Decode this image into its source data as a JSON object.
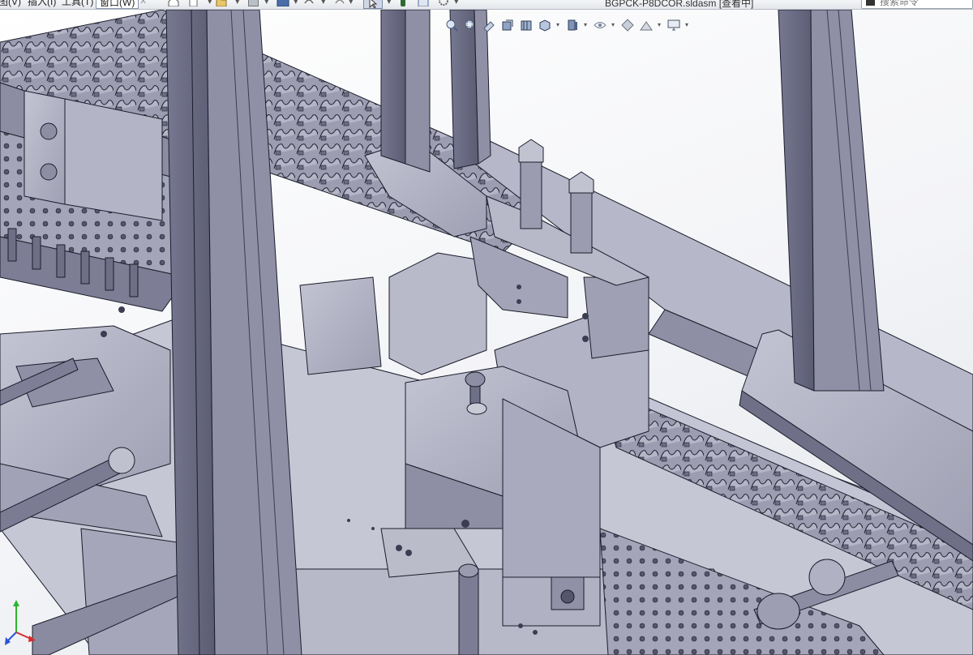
{
  "menu": {
    "view": "图(V)",
    "insert": "插入(I)",
    "tools": "工具(T)",
    "window": "窗口(W)"
  },
  "document": {
    "title": "BGPCK-P8DCOR.sldasm [查看中]"
  },
  "search": {
    "placeholder": "搜索命令",
    "value": ""
  },
  "toolbar": {
    "icons": [
      "home-icon",
      "new-document-icon",
      "open-folder-icon",
      "save-icon",
      "print-icon",
      "undo-icon",
      "redo-icon",
      "select-arrow-icon",
      "traffic-light-icon",
      "file-properties-icon",
      "options-gear-icon"
    ]
  },
  "heads_up_toolbar": {
    "icons": [
      "zoom-to-fit-icon",
      "zoom-area-icon",
      "previous-view-icon",
      "section-view-icon",
      "dynamic-annotation-icon",
      "view-orientation-icon",
      "display-style-icon",
      "hide-show-items-icon",
      "edit-appearance-icon",
      "apply-scene-icon",
      "view-settings-icon"
    ]
  },
  "viewport": {
    "background_top": "#ffffff",
    "background_bottom": "#e4e6eb",
    "model_color": "#a7a8bb",
    "edge_color": "#1b1c2a"
  },
  "triad": {
    "x_color": "#d92b2b",
    "y_color": "#2bb52b",
    "z_color": "#2b54d9"
  }
}
